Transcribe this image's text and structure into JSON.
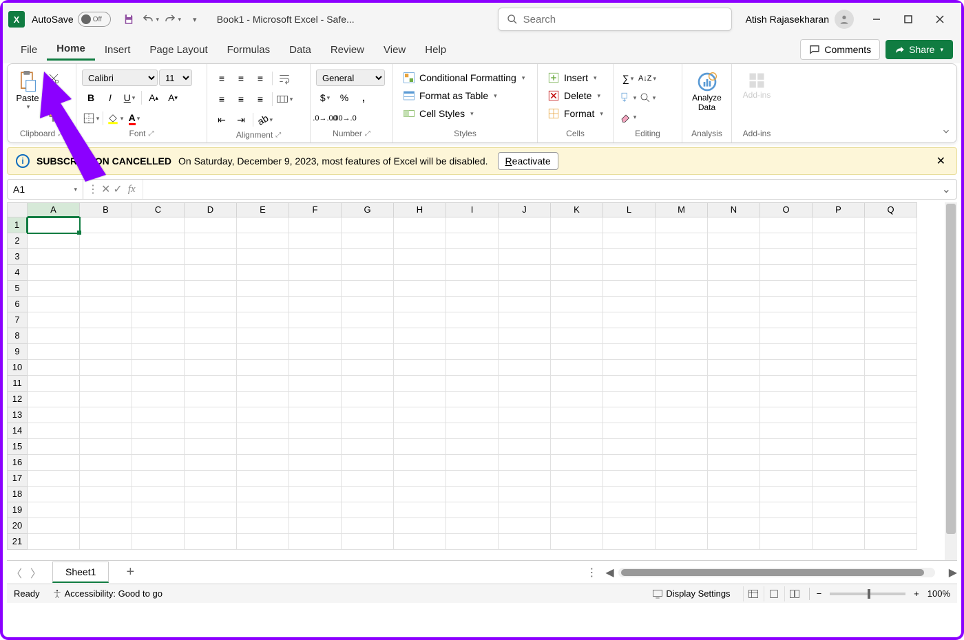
{
  "titlebar": {
    "autosave_label": "AutoSave",
    "autosave_state": "Off",
    "title": "Book1  -  Microsoft Excel  -  Safe...",
    "search_placeholder": "Search",
    "user_name": "Atish Rajasekharan"
  },
  "tabs": {
    "items": [
      "File",
      "Home",
      "Insert",
      "Page Layout",
      "Formulas",
      "Data",
      "Review",
      "View",
      "Help"
    ],
    "active": "Home",
    "comments": "Comments",
    "share": "Share"
  },
  "ribbon": {
    "clipboard": {
      "paste": "Paste",
      "label": "Clipboard"
    },
    "font": {
      "name": "Calibri",
      "size": "11",
      "label": "Font"
    },
    "alignment": {
      "label": "Alignment"
    },
    "number": {
      "format": "General",
      "label": "Number"
    },
    "styles": {
      "conditional": "Conditional Formatting",
      "table": "Format as Table",
      "cell": "Cell Styles",
      "label": "Styles"
    },
    "cells": {
      "insert": "Insert",
      "delete": "Delete",
      "format": "Format",
      "label": "Cells"
    },
    "editing": {
      "label": "Editing"
    },
    "analysis": {
      "analyze": "Analyze Data",
      "label": "Analysis"
    },
    "addins": {
      "btn": "Add-ins",
      "label": "Add-ins"
    }
  },
  "messagebar": {
    "title": "SUBSCRIPTION CANCELLED",
    "text": "On Saturday, December 9, 2023, most features of Excel will be disabled.",
    "button": "Reactivate"
  },
  "formula": {
    "namebox": "A1",
    "value": ""
  },
  "grid": {
    "columns": [
      "A",
      "B",
      "C",
      "D",
      "E",
      "F",
      "G",
      "H",
      "I",
      "J",
      "K",
      "L",
      "M",
      "N",
      "O",
      "P",
      "Q"
    ],
    "rows": [
      1,
      2,
      3,
      4,
      5,
      6,
      7,
      8,
      9,
      10,
      11,
      12,
      13,
      14,
      15,
      16,
      17,
      18,
      19,
      20,
      21
    ],
    "active_cell": "A1"
  },
  "sheets": {
    "active": "Sheet1"
  },
  "statusbar": {
    "ready": "Ready",
    "accessibility": "Accessibility: Good to go",
    "display": "Display Settings",
    "zoom": "100%"
  }
}
